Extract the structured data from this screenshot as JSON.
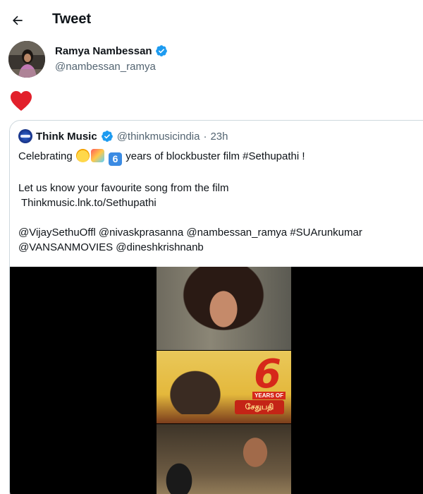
{
  "header": {
    "back_icon": "arrow-left-icon",
    "title": "Tweet"
  },
  "author": {
    "name": "Ramya Nambessan",
    "handle": "@nambessan_ramya",
    "verified": true
  },
  "tweet": {
    "content_icon": "red-heart-icon"
  },
  "quote": {
    "name": "Think Music",
    "handle": "@thinkmusicindia",
    "separator": "·",
    "time": "23h",
    "verified": true,
    "line1_prefix": "Celebrating",
    "line1_suffix": "years of blockbuster film #Sethupathi !",
    "line2": "Let us know your favourite song from the film",
    "link": "Thinkmusic.lnk.to/Sethupathi",
    "line4": "@VijaySethuOffl @nivaskprasanna @nambessan_ramya #SUArunkumar",
    "line5": "@VANSANMOVIES @dineshkrishnanb",
    "emojis": [
      "partying-face-emoji",
      "party-popper-emoji",
      "keycap-six-emoji"
    ],
    "six_glyph": "6"
  },
  "media": {
    "poster_number": "6",
    "poster_badge": "YEARS OF",
    "poster_title": "சேதுபதி"
  },
  "colors": {
    "verified": "#1d9bf0",
    "heart": "#f91880",
    "secondary_text": "#536471",
    "border": "#cfd9de"
  }
}
